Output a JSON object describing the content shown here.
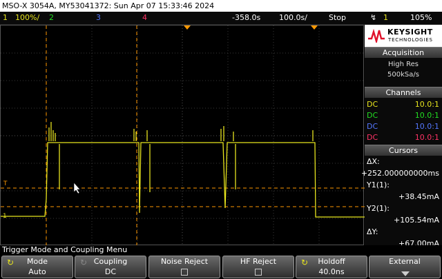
{
  "title_bar": "MSO-X 3054A, MY53041372: Sun Apr 07 15:33:46 2024",
  "status": {
    "ch1_num": "1",
    "ch1_scale": "100%/",
    "ch2_num": "2",
    "ch3_num": "3",
    "ch4_num": "4",
    "time_delay": "-358.0s",
    "time_scale": "100.0s/",
    "run_state": "Stop",
    "trigger_source": "1",
    "trigger_level": "105%"
  },
  "markers": {
    "trigger_level": "T",
    "ch1_ground": "1"
  },
  "logo": {
    "brand": "KEYSIGHT",
    "sub": "TECHNOLOGIES"
  },
  "acquisition": {
    "header": "Acquisition",
    "mode": "High Res",
    "rate": "500kSa/s"
  },
  "channels": {
    "header": "Channels",
    "rows": [
      {
        "coupling": "DC",
        "probe": "10.0:1",
        "color": "#e8e51e"
      },
      {
        "coupling": "DC",
        "probe": "10.0:1",
        "color": "#22dd22"
      },
      {
        "coupling": "DC",
        "probe": "10.0:1",
        "color": "#5577ff"
      },
      {
        "coupling": "DC",
        "probe": "10.0:1",
        "color": "#ff3366"
      }
    ]
  },
  "cursors": {
    "header": "Cursors",
    "dx_label": "ΔX:",
    "dx_value": "+252.000000000ms",
    "y1_label": "Y1(1):",
    "y1_value": "+38.45mA",
    "y2_label": "Y2(1):",
    "y2_value": "+105.54mA",
    "dy_label": "ΔY:",
    "dy_value": "+67.00mA"
  },
  "menu_title": "Trigger Mode and Coupling Menu",
  "softkeys": [
    {
      "title": "Mode",
      "value": "Auto"
    },
    {
      "title": "Coupling",
      "value": "DC"
    },
    {
      "title": "Noise Reject",
      "value": ""
    },
    {
      "title": "HF Reject",
      "value": ""
    },
    {
      "title": "Holdoff",
      "value": "40.0ns"
    },
    {
      "title": "External",
      "value": ""
    }
  ],
  "colors": {
    "ch1": "#e8e51e",
    "ch2": "#22dd22",
    "ch3": "#5577ff",
    "ch4": "#ff3366",
    "cursor": "#ff9900",
    "grid": "#3a3a3a"
  }
}
